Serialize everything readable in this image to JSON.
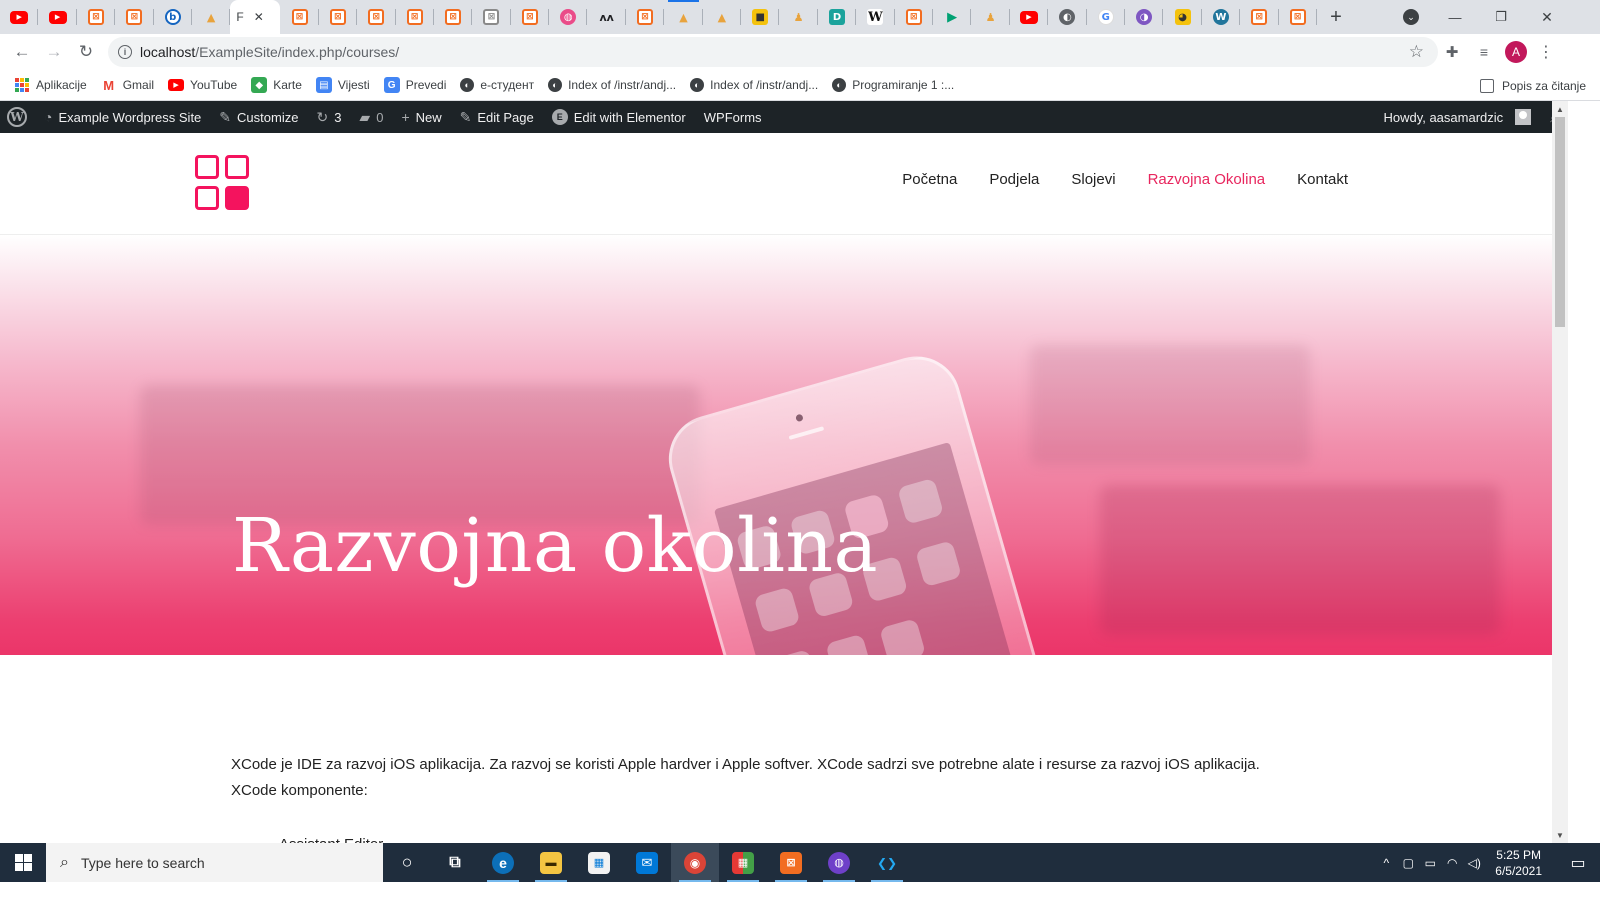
{
  "browser": {
    "tabs": [
      {
        "icon": "youtube-icon",
        "glyph": "▶",
        "style": "yt"
      },
      {
        "icon": "youtube-icon",
        "glyph": "▶",
        "style": "yt"
      },
      {
        "icon": "xampp-icon",
        "glyph": "⊠",
        "style": "xampp"
      },
      {
        "icon": "xampp-icon",
        "glyph": "⊠",
        "style": "xampp"
      },
      {
        "icon": "bold-b-icon",
        "glyph": "b",
        "style": "bold"
      },
      {
        "icon": "phpmyadmin-icon",
        "glyph": "▲",
        "style": "pma"
      },
      {
        "icon": "xampp-icon",
        "glyph": "⊠",
        "style": "xampp"
      },
      {
        "icon": "xampp-icon",
        "glyph": "⊠",
        "style": "xampp"
      },
      {
        "icon": "xampp-icon",
        "glyph": "⊠",
        "style": "xampp"
      },
      {
        "icon": "xampp-icon",
        "glyph": "⊠",
        "style": "xampp"
      },
      {
        "icon": "xampp-icon",
        "glyph": "⊠",
        "style": "xampp"
      },
      {
        "icon": "xampp-gray-icon",
        "glyph": "⊠",
        "style": "xampp-g"
      },
      {
        "icon": "xampp-icon",
        "glyph": "⊠",
        "style": "xampp"
      },
      {
        "icon": "dribbble-icon",
        "glyph": "◍",
        "style": "dribbble"
      },
      {
        "icon": "mountain-icon",
        "glyph": "ʌʌ",
        "style": "dark"
      },
      {
        "icon": "xampp-icon",
        "glyph": "⊠",
        "style": "xampp"
      },
      {
        "icon": "phpmyadmin-icon",
        "glyph": "▲",
        "style": "pma"
      },
      {
        "icon": "phpmyadmin-icon",
        "glyph": "▲",
        "style": "pma"
      },
      {
        "icon": "green-square-icon",
        "glyph": "■",
        "style": "yellow"
      },
      {
        "icon": "person-icon",
        "glyph": "♟",
        "style": "pma"
      },
      {
        "icon": "d-icon",
        "glyph": "D",
        "style": "teal"
      },
      {
        "icon": "wikipedia-icon",
        "glyph": "W",
        "style": "w"
      },
      {
        "icon": "xampp-icon",
        "glyph": "⊠",
        "style": "xampp"
      },
      {
        "icon": "play-icon",
        "glyph": "▶",
        "style": "play"
      },
      {
        "icon": "people-icon",
        "glyph": "♟",
        "style": "pma"
      },
      {
        "icon": "youtube-icon",
        "glyph": "▶",
        "style": "yt"
      },
      {
        "icon": "globe-icon",
        "glyph": "◐",
        "style": "globe"
      },
      {
        "icon": "google-icon",
        "glyph": "G",
        "style": "g"
      },
      {
        "icon": "purple-circle-icon",
        "glyph": "◑",
        "style": "purple"
      },
      {
        "icon": "chick-icon",
        "glyph": "◕",
        "style": "yellow"
      },
      {
        "icon": "wordpress-icon",
        "glyph": "W",
        "style": "wp"
      },
      {
        "icon": "xampp-icon",
        "glyph": "⊠",
        "style": "xampp"
      },
      {
        "icon": "xampp-icon",
        "glyph": "⊠",
        "style": "xampp"
      }
    ],
    "active_tab": {
      "title": "F",
      "close": "✕"
    },
    "new_tab": "+",
    "window_controls": {
      "minimize": "—",
      "restore": "❐",
      "close": "✕",
      "tab_search": "⌄"
    },
    "url_host": "localhost",
    "url_path": "/ExampleSite/index.php/courses/",
    "profile_initial": "A",
    "bookmarks": [
      {
        "label": "Aplikacije",
        "icon": "apps-grid-icon"
      },
      {
        "label": "Gmail",
        "icon": "gmail-icon"
      },
      {
        "label": "YouTube",
        "icon": "youtube-icon"
      },
      {
        "label": "Karte",
        "icon": "maps-icon"
      },
      {
        "label": "Vijesti",
        "icon": "news-icon"
      },
      {
        "label": "Prevedi",
        "icon": "translate-icon"
      },
      {
        "label": "е-студент",
        "icon": "globe-icon"
      },
      {
        "label": "Index of /instr/andj...",
        "icon": "globe-icon"
      },
      {
        "label": "Index of /instr/andj...",
        "icon": "globe-icon"
      },
      {
        "label": "Programiranje 1 :...",
        "icon": "globe-icon"
      }
    ],
    "reading_list": "Popis za čitanje"
  },
  "adminbar": {
    "site_name": "Example Wordpress Site",
    "customize": "Customize",
    "updates_count": "3",
    "comments_count": "0",
    "new": "New",
    "edit_page": "Edit Page",
    "edit_elementor": "Edit with Elementor",
    "wpforms": "WPForms",
    "howdy": "Howdy, aasamardzic"
  },
  "site": {
    "nav": [
      "Početna",
      "Podjela",
      "Slojevi",
      "Razvojna Okolina",
      "Kontakt"
    ],
    "current_nav": "Razvojna Okolina",
    "hero_title": "Razvojna okolina",
    "paragraph_1": "XCode je IDE za razvoj iOS aplikacija. Za razvoj se koristi Apple hardver i Apple softver. XCode sadrzi sve potrebne alate i resurse za razvoj iOS aplikacija.",
    "paragraph_2": "XCode komponente:",
    "list_items": [
      "Assistant Editor"
    ]
  },
  "colors": {
    "accent": "#f4135e",
    "nav_active": "#e8265e",
    "adminbar_bg": "#1d2327",
    "taskbar_bg": "#1f2d3d"
  },
  "taskbar": {
    "search_placeholder": "Type here to search",
    "apps": [
      {
        "icon": "cortana-icon",
        "glyph": "○"
      },
      {
        "icon": "task-view-icon",
        "glyph": "⧉"
      },
      {
        "icon": "edge-icon",
        "glyph": "e"
      },
      {
        "icon": "file-explorer-icon",
        "glyph": "▬"
      },
      {
        "icon": "store-icon",
        "glyph": "▦"
      },
      {
        "icon": "mail-icon",
        "glyph": "✉"
      },
      {
        "icon": "chrome-icon",
        "glyph": "◉"
      },
      {
        "icon": "color-grid-icon",
        "glyph": "▦"
      },
      {
        "icon": "xampp-icon",
        "glyph": "⊠"
      },
      {
        "icon": "github-desktop-icon",
        "glyph": "◍"
      },
      {
        "icon": "vscode-icon",
        "glyph": "❮❯"
      }
    ],
    "time": "5:25 PM",
    "date": "6/5/2021"
  }
}
